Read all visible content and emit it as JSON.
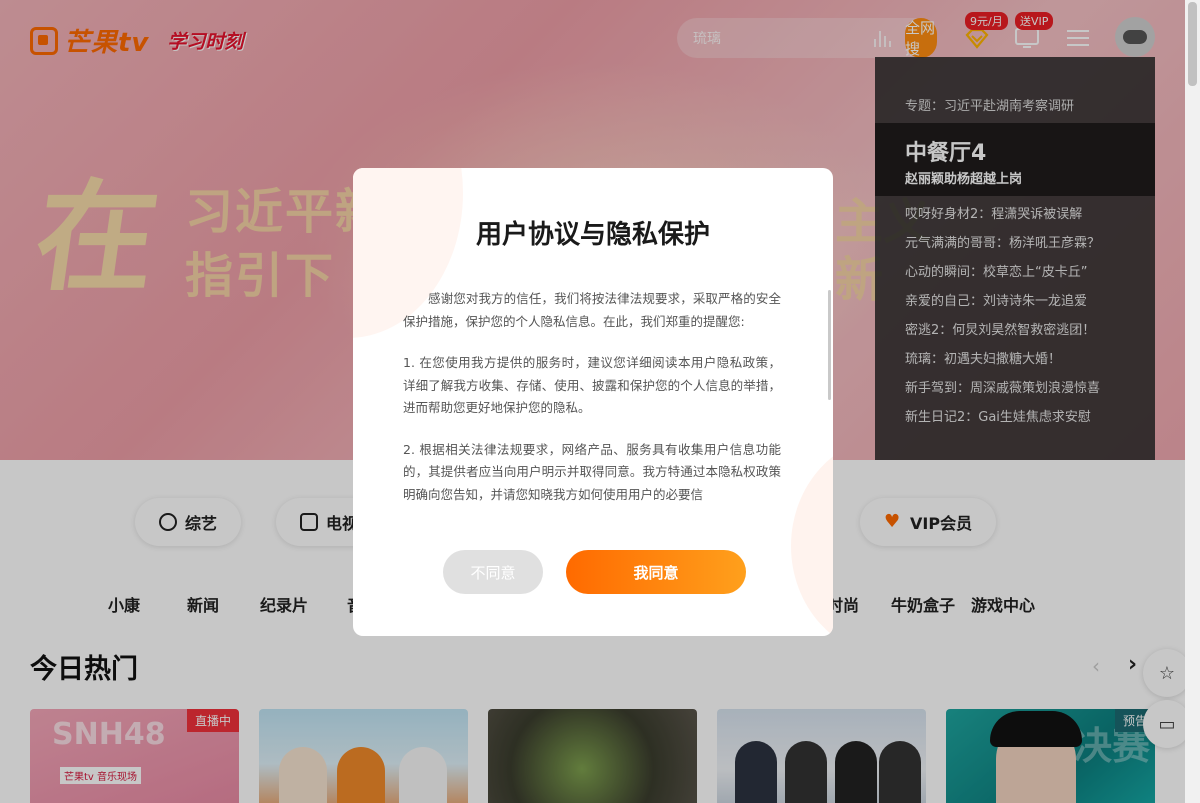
{
  "header": {
    "logo_text": "芒果tv",
    "slogan": "学习时刻",
    "search_placeholder": "琉璃",
    "search_button": "全网搜",
    "vip_badge": "9元/月",
    "tv_badge": "送VIP"
  },
  "hero": {
    "big_char": "在",
    "line1": "习近平新",
    "line2": "指引下",
    "right1": "主义",
    "right2": "新"
  },
  "side_panel": {
    "topic": "专题：习近平赴湖南考察调研",
    "feature_title": "中餐厅4",
    "feature_subtitle": "赵丽颖助杨超越上岗",
    "items": [
      "哎呀好身材2：程潇哭诉被误解",
      "元气满满的哥哥：杨洋吼王彦霖？",
      "心动的瞬间：校草恋上“皮卡丘”",
      "亲爱的自己：刘诗诗朱一龙追爱",
      "密逃2：何炅刘昊然智救密逃团！",
      "琉璃：初遇夫妇撒糖大婚！",
      "新手驾到：周深戚薇策划浪漫惊喜",
      "新生日记2：Gai生娃焦虑求安慰"
    ]
  },
  "categories": [
    {
      "label": "综艺",
      "icon": "search-icon"
    },
    {
      "label": "电视剧",
      "icon": "tv-icon"
    },
    {
      "label": "VIP会员",
      "icon": "vip-heart-icon"
    }
  ],
  "subnav": [
    "小康",
    "新闻",
    "纪录片",
    "音乐",
    "时尚",
    "牛奶盒子",
    "游戏中心"
  ],
  "section": {
    "title": "今日热门"
  },
  "cards": [
    {
      "tag": "直播中",
      "overlay": "SNH48",
      "brand": "芒果tv 音乐现场"
    },
    {
      "tag": ""
    },
    {
      "tag": ""
    },
    {
      "tag": ""
    },
    {
      "tag": "预告",
      "overlay": "总决赛"
    }
  ],
  "modal": {
    "title": "用户协议与隐私保护",
    "paragraphs": [
      "感谢您对我方的信任，我们将按法律法规要求，采取严格的安全保护措施，保护您的个人隐私信息。在此，我们郑重的提醒您:",
      "1. 在您使用我方提供的服务时，建议您详细阅读本用户隐私政策，详细了解我方收集、存储、使用、披露和保护您的个人信息的举措，进而帮助您更好地保护您的隐私。",
      "2. 根据相关法律法规要求，网络产品、服务具有收集用户信息功能的，其提供者应当向用户明示并取得同意。我方特通过本隐私权政策明确向您告知，并请您知晓我方如何使用用户的必要信"
    ],
    "disagree_label": "不同意",
    "agree_label": "我同意"
  },
  "colors": {
    "brand_orange": "#ff6a00",
    "live_red": "#f1313b"
  }
}
